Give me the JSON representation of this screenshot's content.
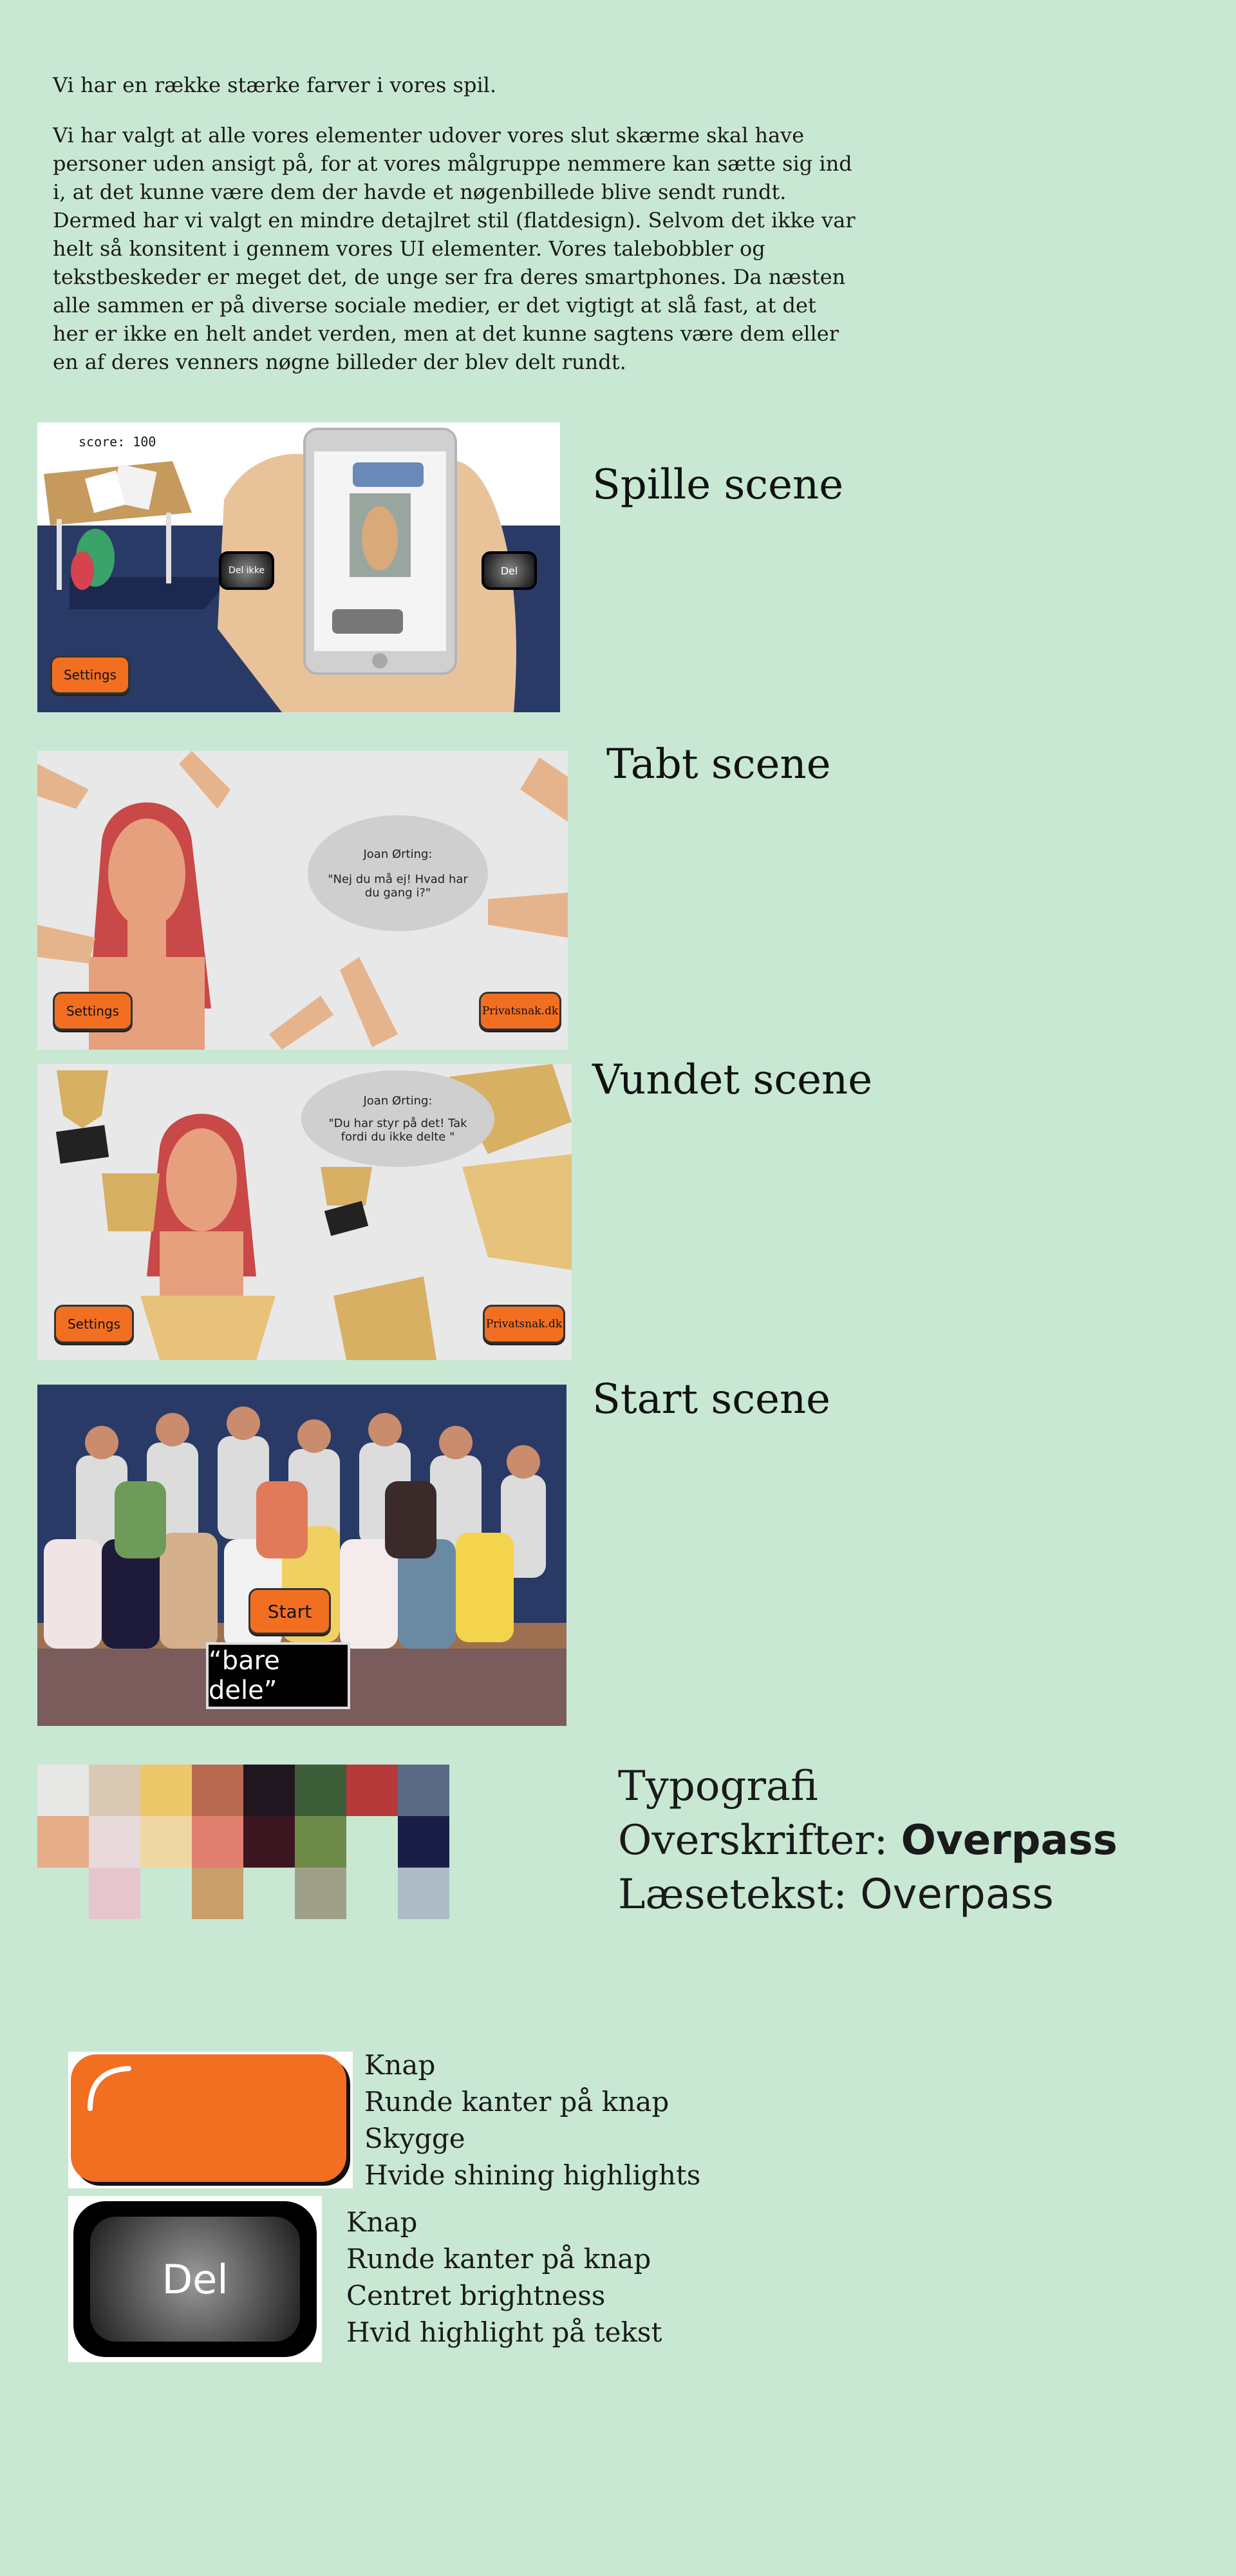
{
  "intro": {
    "paragraph1": "Vi har en række stærke farver i vores spil.",
    "paragraph2": "Vi har valgt at alle vores elementer udover vores slut skærme skal have personer uden ansigt på, for at vores målgruppe nemmere kan sætte sig ind i, at det kunne være dem der havde et nøgenbillede blive sendt rundt. Dermed har vi valgt en mindre detajlret stil (flatdesign). Selvom det ikke var helt så konsitent i gennem vores UI elementer. Vores talebobbler og tekstbeskeder er meget det, de unge ser fra deres smartphones. Da næsten alle sammen er på diverse sociale medier, er det vigtigt at slå fast, at det her er ikke en helt andet verden, men at det kunne sagtens være dem eller en af deres venners nøgne billeder der blev delt rundt."
  },
  "scenes": {
    "play": {
      "title": "Spille scene",
      "score": "score: 100",
      "btn_dont_share": "Del ikke",
      "btn_share": "Del",
      "btn_settings": "Settings"
    },
    "lost": {
      "title": "Tabt scene",
      "speaker": "Joan Ørting:",
      "quote": "\"Nej du må ej! Hvad har du gang i?\"",
      "btn_settings": "Settings",
      "btn_link": "Privatsnak.dk"
    },
    "won": {
      "title": "Vundet scene",
      "speaker": "Joan Ørting:",
      "quote": "\"Du har styr på det! Tak fordi du ikke delte \"",
      "btn_settings": "Settings",
      "btn_link": "Privatsnak.dk"
    },
    "start": {
      "title": "Start scene",
      "btn_start": "Start",
      "sign": "“bare dele”"
    }
  },
  "palette": {
    "row1": [
      "#e8e8e6",
      "#d9c9b4",
      "#ecc86a",
      "#b86a50",
      "#1f1620",
      "#3e5e3a",
      "#b63a3a",
      "#5a6a84"
    ],
    "row2": [
      "#e6ad88",
      "#e8dada",
      "#efd7a4",
      "#e08070",
      "#3b1520",
      "#6e8a48",
      "",
      "#1a1d48"
    ],
    "row3": [
      "",
      "#e6c6cc",
      "",
      "#c89e6a",
      "",
      "#a0a08a",
      "",
      "#aebcc8"
    ]
  },
  "typography": {
    "title": "Typografi",
    "headings_label": "Overskrifter:",
    "headings_font": "Overpass",
    "body_label": "Læsetekst:",
    "body_font": "Overpass"
  },
  "buttons": {
    "orange": {
      "lines": [
        "Knap",
        "Runde kanter på knap",
        "Skygge",
        "Hvide shining highlights"
      ]
    },
    "dark": {
      "label": "Del",
      "lines": [
        "Knap",
        "Runde kanter på knap",
        "Centret brightness",
        "Hvid highlight på tekst"
      ]
    }
  }
}
